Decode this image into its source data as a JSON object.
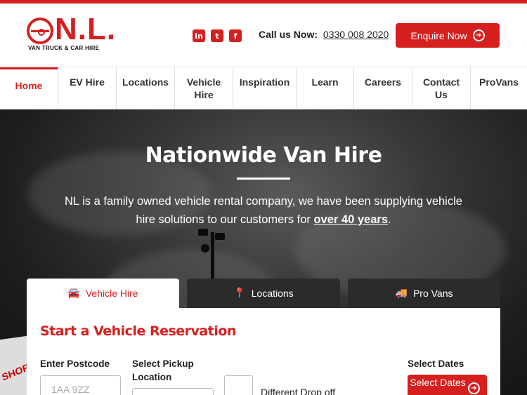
{
  "brand": {
    "logo_text": "N.L.",
    "logo_subtitle": "VAN TRUCK & CAR HIRE",
    "accent_color": "#d6201f"
  },
  "header": {
    "socials": [
      {
        "name": "linkedin-icon",
        "glyph": "in"
      },
      {
        "name": "twitter-icon",
        "glyph": "t"
      },
      {
        "name": "facebook-icon",
        "glyph": "f"
      }
    ],
    "call_label": "Call us Now:",
    "call_number": "0330 008 2020",
    "enquire_label": "Enquire Now"
  },
  "nav": {
    "items": [
      {
        "label": "Home",
        "active": true
      },
      {
        "label": "EV Hire"
      },
      {
        "label": "Locations"
      },
      {
        "label": "Vehicle Hire"
      },
      {
        "label": "Inspiration"
      },
      {
        "label": "Learn"
      },
      {
        "label": "Careers"
      },
      {
        "label": "Contact Us"
      },
      {
        "label": "ProVans"
      }
    ]
  },
  "hero": {
    "title": "Nationwide Van Hire",
    "subtitle_before": "NL is a family owned vehicle rental company, we have been supplying vehicle hire solutions to our customers for ",
    "subtitle_highlight": "over 40 years",
    "subtitle_after": ".",
    "sign_text": "SHORT"
  },
  "tabs": [
    {
      "label": "Vehicle Hire",
      "icon": "car-icon",
      "active": true
    },
    {
      "label": "Locations",
      "icon": "map-pin-icon"
    },
    {
      "label": "Pro Vans",
      "icon": "truck-icon"
    }
  ],
  "reservation": {
    "title": "Start a Vehicle Reservation",
    "postcode_label": "Enter Postcode",
    "postcode_placeholder": "1AA 9ZZ",
    "pickup_label": "Select Pickup Location",
    "dropoff_label": "Different Drop off",
    "dates_label": "Select Dates",
    "dates_button": "Select Dates"
  }
}
